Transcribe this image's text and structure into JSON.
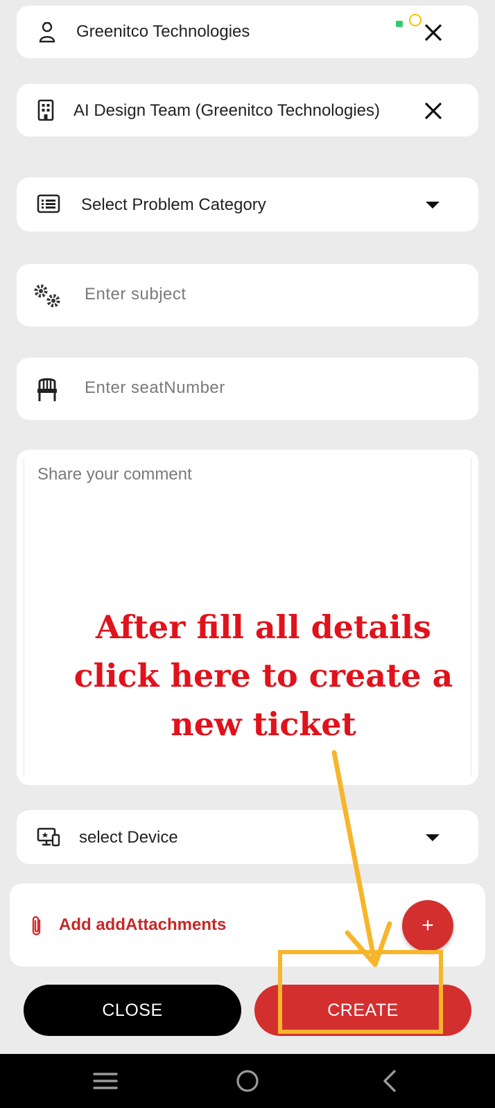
{
  "form": {
    "company": {
      "value": "Greenitco Technologies",
      "icon": "user-icon"
    },
    "team": {
      "value": "AI Design Team (Greenitco Technologies)",
      "icon": "building-icon"
    },
    "category": {
      "value": "Select Problem Category",
      "icon": "list-icon"
    },
    "subject": {
      "placeholder": "Enter subject",
      "icon": "gears-icon"
    },
    "seat": {
      "placeholder": "Enter seatNumber",
      "icon": "chair-icon"
    },
    "comment": {
      "placeholder": "Share your comment"
    },
    "device": {
      "value": "select Device",
      "icon": "device-icon"
    },
    "attachments": {
      "label": "Add addAttachments",
      "add_symbol": "+"
    }
  },
  "annotation": {
    "line1": "After fill all details",
    "line2": "click here to create a",
    "line3": "new ticket",
    "color": "#e0121b",
    "arrow_color": "#f7b52c"
  },
  "actions": {
    "close_label": "CLOSE",
    "create_label": "CREATE"
  },
  "colors": {
    "accent": "#d32f2f",
    "background": "#ebebeb"
  }
}
